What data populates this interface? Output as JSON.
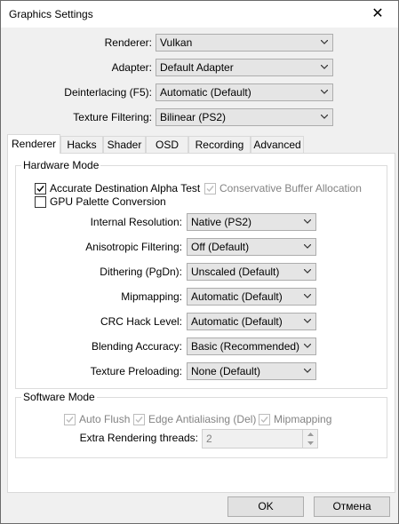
{
  "window": {
    "title": "Graphics Settings"
  },
  "top_settings": [
    {
      "label": "Renderer:",
      "value": "Vulkan"
    },
    {
      "label": "Adapter:",
      "value": "Default Adapter"
    },
    {
      "label": "Deinterlacing (F5):",
      "value": "Automatic (Default)"
    },
    {
      "label": "Texture Filtering:",
      "value": "Bilinear (PS2)"
    }
  ],
  "tabs": [
    {
      "label": "Renderer",
      "active": true
    },
    {
      "label": "Hacks"
    },
    {
      "label": "Shader"
    },
    {
      "label": "OSD"
    },
    {
      "label": "Recording"
    },
    {
      "label": "Advanced"
    }
  ],
  "hardware_mode": {
    "title": "Hardware Mode",
    "checks": [
      {
        "label": "Accurate Destination Alpha Test",
        "checked": true,
        "enabled": true
      },
      {
        "label": "Conservative Buffer Allocation",
        "checked": true,
        "enabled": false
      },
      {
        "label": "GPU Palette Conversion",
        "checked": false,
        "enabled": true
      }
    ],
    "settings": [
      {
        "label": "Internal Resolution:",
        "value": "Native (PS2)"
      },
      {
        "label": "Anisotropic Filtering:",
        "value": "Off (Default)"
      },
      {
        "label": "Dithering (PgDn):",
        "value": "Unscaled (Default)"
      },
      {
        "label": "Mipmapping:",
        "value": "Automatic (Default)"
      },
      {
        "label": "CRC Hack Level:",
        "value": "Automatic (Default)"
      },
      {
        "label": "Blending Accuracy:",
        "value": "Basic (Recommended)"
      },
      {
        "label": "Texture Preloading:",
        "value": "None (Default)"
      }
    ]
  },
  "software_mode": {
    "title": "Software Mode",
    "checks": [
      {
        "label": "Auto Flush",
        "checked": true,
        "enabled": false
      },
      {
        "label": "Edge Antialiasing (Del)",
        "checked": true,
        "enabled": false
      },
      {
        "label": "Mipmapping",
        "checked": true,
        "enabled": false
      }
    ],
    "threads_label": "Extra Rendering threads:",
    "threads_value": "2"
  },
  "buttons": {
    "ok": "OK",
    "cancel": "Отмена"
  },
  "colors": {
    "check_enabled": "#000000",
    "check_disabled": "#bcbcbc",
    "accent_border": "#adadad"
  }
}
